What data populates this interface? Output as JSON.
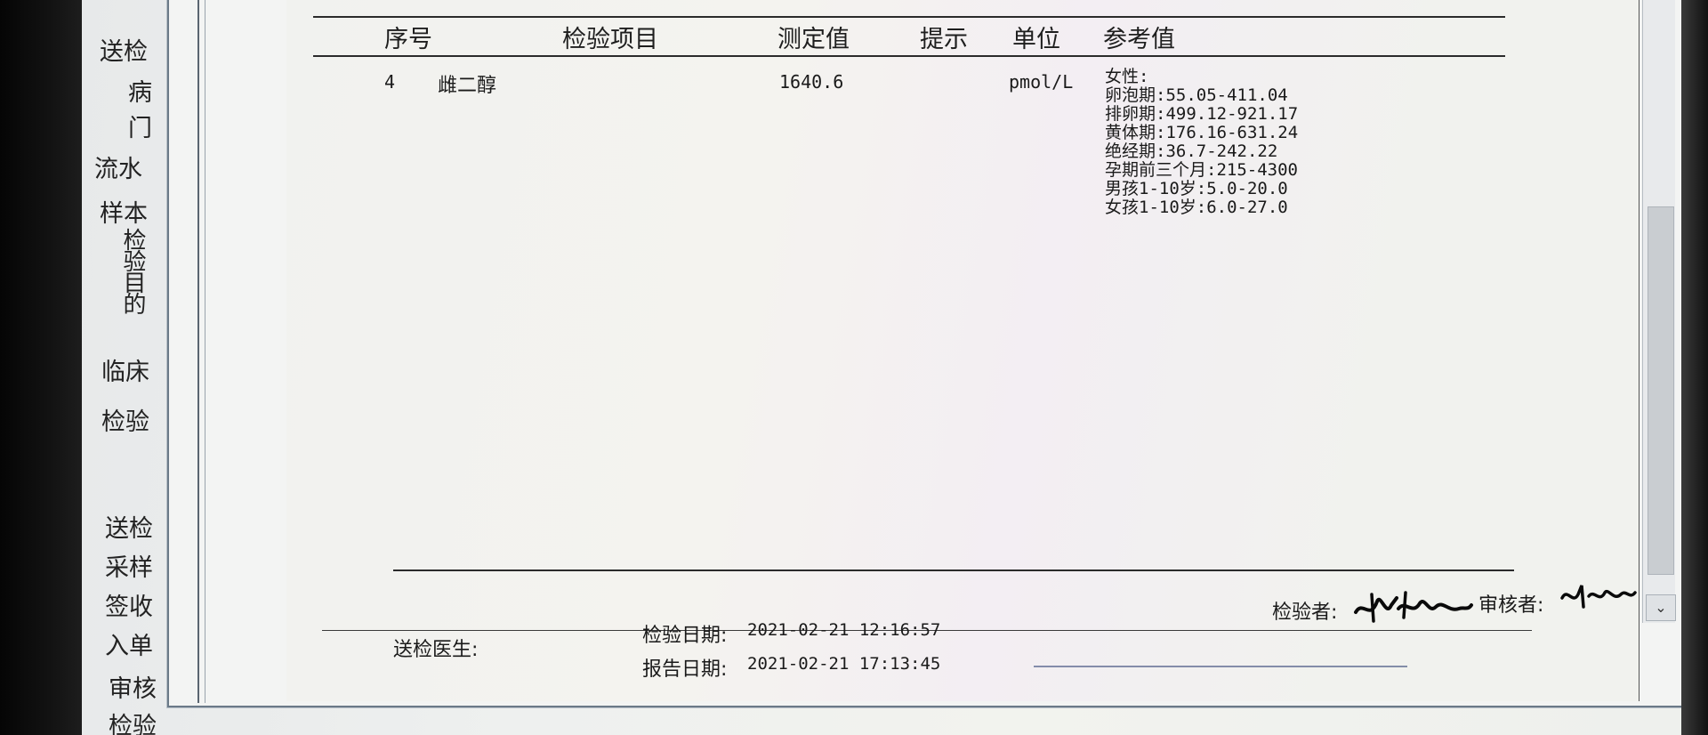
{
  "background_form": {
    "labels": [
      "送检",
      "病",
      "门",
      "流水",
      "样本",
      "检验目的",
      "临床",
      "检验",
      "送检",
      "采样",
      "签收",
      "入单",
      "审核",
      "检验"
    ]
  },
  "report": {
    "headers": {
      "seq": "序号",
      "item": "检验项目",
      "value": "测定值",
      "hint": "提示",
      "unit": "单位",
      "ref": "参考值"
    },
    "rows": [
      {
        "seq": "4",
        "item": "雌二醇",
        "value": "1640.6",
        "hint": "",
        "unit": "pmol/L",
        "ref_lines": [
          "女性:",
          "卵泡期:55.05-411.04",
          "排卵期:499.12-921.17",
          "黄体期:176.16-631.24",
          "绝经期:36.7-242.22",
          "孕期前三个月:215-4300",
          "男孩1-10岁:5.0-20.0",
          "女孩1-10岁:6.0-27.0"
        ]
      }
    ],
    "footer": {
      "inspector_label": "检验者:",
      "reviewer_label": "审核者:",
      "doctor_label": "送检医生:",
      "doctor_value": "",
      "test_date_label": "检验日期:",
      "test_date_value": "2021-02-21 12:16:57",
      "report_date_label": "报告日期:",
      "report_date_value": "2021-02-21 17:13:45"
    }
  },
  "scrollbar": {
    "down_arrow": "chevron-down-icon"
  }
}
